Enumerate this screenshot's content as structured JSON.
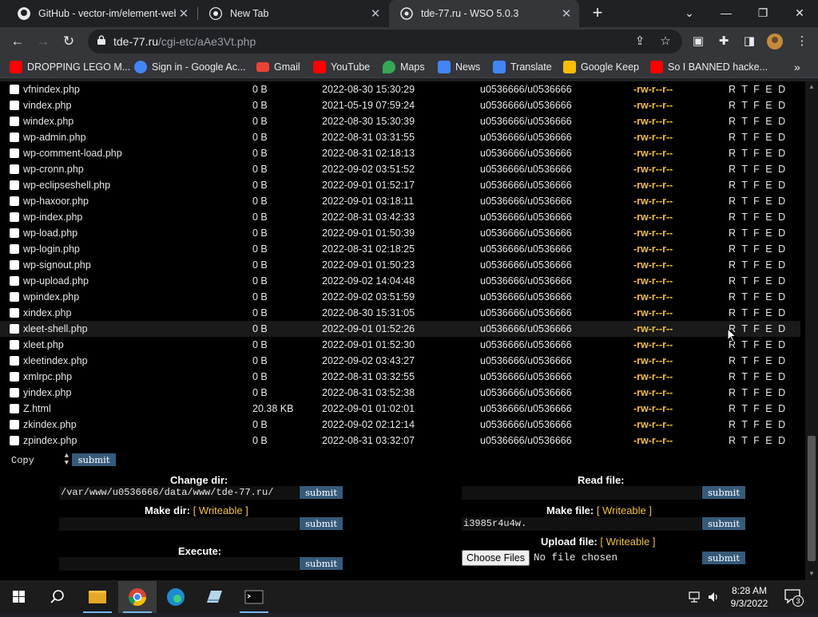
{
  "browser": {
    "tabs": [
      {
        "title": "GitHub - vector-im/element-web",
        "icon": "github-icon"
      },
      {
        "title": "New Tab",
        "icon": "chrome-icon"
      },
      {
        "title": "tde-77.ru - WSO 5.0.3",
        "icon": "globe-icon",
        "active": true
      }
    ],
    "url_host": "tde-77.ru",
    "url_path": "/cgi-etc/aAe3Vt.php",
    "bookmarks": [
      {
        "label": "DROPPING LEGO M...",
        "icon": "youtube-icon",
        "color": "#ff0000"
      },
      {
        "label": "Sign in - Google Ac...",
        "icon": "google-icon",
        "color": "#4285f4"
      },
      {
        "label": "Gmail",
        "icon": "gmail-icon",
        "color": "#ea4335"
      },
      {
        "label": "YouTube",
        "icon": "youtube-icon",
        "color": "#ff0000"
      },
      {
        "label": "Maps",
        "icon": "maps-icon",
        "color": "#34a853"
      },
      {
        "label": "News",
        "icon": "news-icon",
        "color": "#4285f4"
      },
      {
        "label": "Translate",
        "icon": "translate-icon",
        "color": "#4285f4"
      },
      {
        "label": "Google Keep",
        "icon": "keep-icon",
        "color": "#fbbc04"
      },
      {
        "label": "So I BANNED hacke...",
        "icon": "youtube-icon",
        "color": "#ff0000"
      }
    ]
  },
  "files": [
    {
      "name": "vfnindex.php",
      "size": "0 B",
      "modified": "2022-08-30 15:30:29",
      "owner": "u0536666/u0536666",
      "perms": "-rw-r--r--",
      "actions": "R T F E D"
    },
    {
      "name": "vindex.php",
      "size": "0 B",
      "modified": "2021-05-19 07:59:24",
      "owner": "u0536666/u0536666",
      "perms": "-rw-r--r--",
      "actions": "R T F E D"
    },
    {
      "name": "windex.php",
      "size": "0 B",
      "modified": "2022-08-30 15:30:39",
      "owner": "u0536666/u0536666",
      "perms": "-rw-r--r--",
      "actions": "R T F E D"
    },
    {
      "name": "wp-admin.php",
      "size": "0 B",
      "modified": "2022-08-31 03:31:55",
      "owner": "u0536666/u0536666",
      "perms": "-rw-r--r--",
      "actions": "R T F E D"
    },
    {
      "name": "wp-comment-load.php",
      "size": "0 B",
      "modified": "2022-08-31 02:18:13",
      "owner": "u0536666/u0536666",
      "perms": "-rw-r--r--",
      "actions": "R T F E D"
    },
    {
      "name": "wp-cronn.php",
      "size": "0 B",
      "modified": "2022-09-02 03:51:52",
      "owner": "u0536666/u0536666",
      "perms": "-rw-r--r--",
      "actions": "R T F E D"
    },
    {
      "name": "wp-eclipseshell.php",
      "size": "0 B",
      "modified": "2022-09-01 01:52:17",
      "owner": "u0536666/u0536666",
      "perms": "-rw-r--r--",
      "actions": "R T F E D"
    },
    {
      "name": "wp-haxoor.php",
      "size": "0 B",
      "modified": "2022-09-01 03:18:11",
      "owner": "u0536666/u0536666",
      "perms": "-rw-r--r--",
      "actions": "R T F E D"
    },
    {
      "name": "wp-index.php",
      "size": "0 B",
      "modified": "2022-08-31 03:42:33",
      "owner": "u0536666/u0536666",
      "perms": "-rw-r--r--",
      "actions": "R T F E D"
    },
    {
      "name": "wp-load.php",
      "size": "0 B",
      "modified": "2022-09-01 01:50:39",
      "owner": "u0536666/u0536666",
      "perms": "-rw-r--r--",
      "actions": "R T F E D"
    },
    {
      "name": "wp-login.php",
      "size": "0 B",
      "modified": "2022-08-31 02:18:25",
      "owner": "u0536666/u0536666",
      "perms": "-rw-r--r--",
      "actions": "R T F E D"
    },
    {
      "name": "wp-signout.php",
      "size": "0 B",
      "modified": "2022-09-01 01:50:23",
      "owner": "u0536666/u0536666",
      "perms": "-rw-r--r--",
      "actions": "R T F E D"
    },
    {
      "name": "wp-upload.php",
      "size": "0 B",
      "modified": "2022-09-02 14:04:48",
      "owner": "u0536666/u0536666",
      "perms": "-rw-r--r--",
      "actions": "R T F E D"
    },
    {
      "name": "wpindex.php",
      "size": "0 B",
      "modified": "2022-09-02 03:51:59",
      "owner": "u0536666/u0536666",
      "perms": "-rw-r--r--",
      "actions": "R T F E D"
    },
    {
      "name": "xindex.php",
      "size": "0 B",
      "modified": "2022-08-30 15:31:05",
      "owner": "u0536666/u0536666",
      "perms": "-rw-r--r--",
      "actions": "R T F E D"
    },
    {
      "name": "xleet-shell.php",
      "size": "0 B",
      "modified": "2022-09-01 01:52:26",
      "owner": "u0536666/u0536666",
      "perms": "-rw-r--r--",
      "actions": "R T F E D",
      "hover": true
    },
    {
      "name": "xleet.php",
      "size": "0 B",
      "modified": "2022-09-01 01:52:30",
      "owner": "u0536666/u0536666",
      "perms": "-rw-r--r--",
      "actions": "R T F E D"
    },
    {
      "name": "xleetindex.php",
      "size": "0 B",
      "modified": "2022-09-02 03:43:27",
      "owner": "u0536666/u0536666",
      "perms": "-rw-r--r--",
      "actions": "R T F E D"
    },
    {
      "name": "xmlrpc.php",
      "size": "0 B",
      "modified": "2022-08-31 03:32:55",
      "owner": "u0536666/u0536666",
      "perms": "-rw-r--r--",
      "actions": "R T F E D"
    },
    {
      "name": "yindex.php",
      "size": "0 B",
      "modified": "2022-08-31 03:52:38",
      "owner": "u0536666/u0536666",
      "perms": "-rw-r--r--",
      "actions": "R T F E D"
    },
    {
      "name": "Z.html",
      "size": "20.38 KB",
      "modified": "2022-09-01 01:02:01",
      "owner": "u0536666/u0536666",
      "perms": "-rw-r--r--",
      "actions": "R T F E D"
    },
    {
      "name": "zkindex.php",
      "size": "0 B",
      "modified": "2022-09-02 02:12:14",
      "owner": "u0536666/u0536666",
      "perms": "-rw-r--r--",
      "actions": "R T F E D"
    },
    {
      "name": "zpindex.php",
      "size": "0 B",
      "modified": "2022-08-31 03:32:07",
      "owner": "u0536666/u0536666",
      "perms": "-rw-r--r--",
      "actions": "R T F E D"
    }
  ],
  "bulk": {
    "action": "Copy",
    "submit": "submit"
  },
  "forms": {
    "change_dir": {
      "label": "Change dir:",
      "value": "/var/www/u0536666/data/www/tde-77.ru/",
      "submit": "submit"
    },
    "make_dir": {
      "label": "Make dir:",
      "writeable": "[ Writeable ]",
      "value": "",
      "submit": "submit"
    },
    "execute": {
      "label": "Execute:",
      "value": "",
      "submit": "submit"
    },
    "read_file": {
      "label": "Read file:",
      "value": "",
      "submit": "submit"
    },
    "make_file": {
      "label": "Make file:",
      "writeable": "[ Writeable ]",
      "value": "i3985r4u4w.",
      "submit": "submit"
    },
    "upload_file": {
      "label": "Upload file:",
      "writeable": "[ Writeable ]",
      "choose": "Choose Files",
      "no_file": "No file chosen",
      "submit": "submit"
    }
  },
  "taskbar": {
    "time": "8:28 AM",
    "date": "9/3/2022",
    "notifications": "3"
  },
  "colors": {
    "perm": "#f0c040",
    "button": "#365a7a",
    "page_bg": "#000000"
  }
}
